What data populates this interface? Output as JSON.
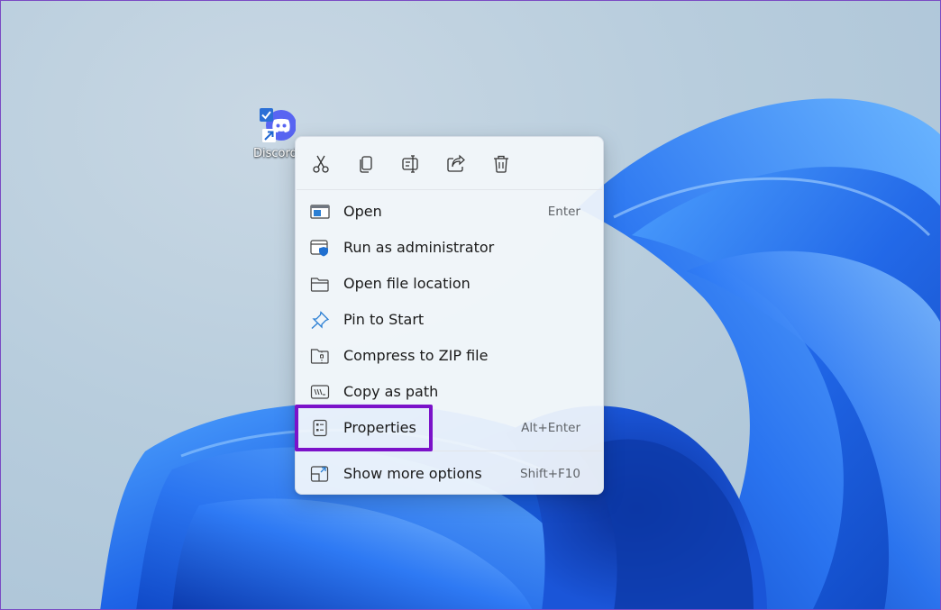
{
  "desktop": {
    "shortcut_label": "Discord",
    "app_icon": "discord-icon",
    "checkbox_icon": "checkmark-icon",
    "shortcut_badge_icon": "shortcut-arrow-icon"
  },
  "context_menu": {
    "quick_actions": [
      {
        "name": "cut",
        "icon": "scissors-icon"
      },
      {
        "name": "copy",
        "icon": "copy-icon"
      },
      {
        "name": "rename",
        "icon": "rename-icon"
      },
      {
        "name": "share",
        "icon": "share-icon"
      },
      {
        "name": "delete",
        "icon": "trash-icon"
      }
    ],
    "items": [
      {
        "label": "Open",
        "shortcut": "Enter",
        "icon": "open-window-icon"
      },
      {
        "label": "Run as administrator",
        "shortcut": "",
        "icon": "shield-icon"
      },
      {
        "label": "Open file location",
        "shortcut": "",
        "icon": "folder-icon"
      },
      {
        "label": "Pin to Start",
        "shortcut": "",
        "icon": "pin-icon"
      },
      {
        "label": "Compress to ZIP file",
        "shortcut": "",
        "icon": "zip-folder-icon"
      },
      {
        "label": "Copy as path",
        "shortcut": "",
        "icon": "path-icon"
      },
      {
        "label": "Properties",
        "shortcut": "Alt+Enter",
        "icon": "properties-icon"
      },
      {
        "label": "Show more options",
        "shortcut": "Shift+F10",
        "icon": "more-options-icon"
      }
    ]
  },
  "colors": {
    "highlight_border": "#7b12c9",
    "icon_accent": "#2b7fd4",
    "wallpaper_bloom": "#1a5fe0"
  }
}
